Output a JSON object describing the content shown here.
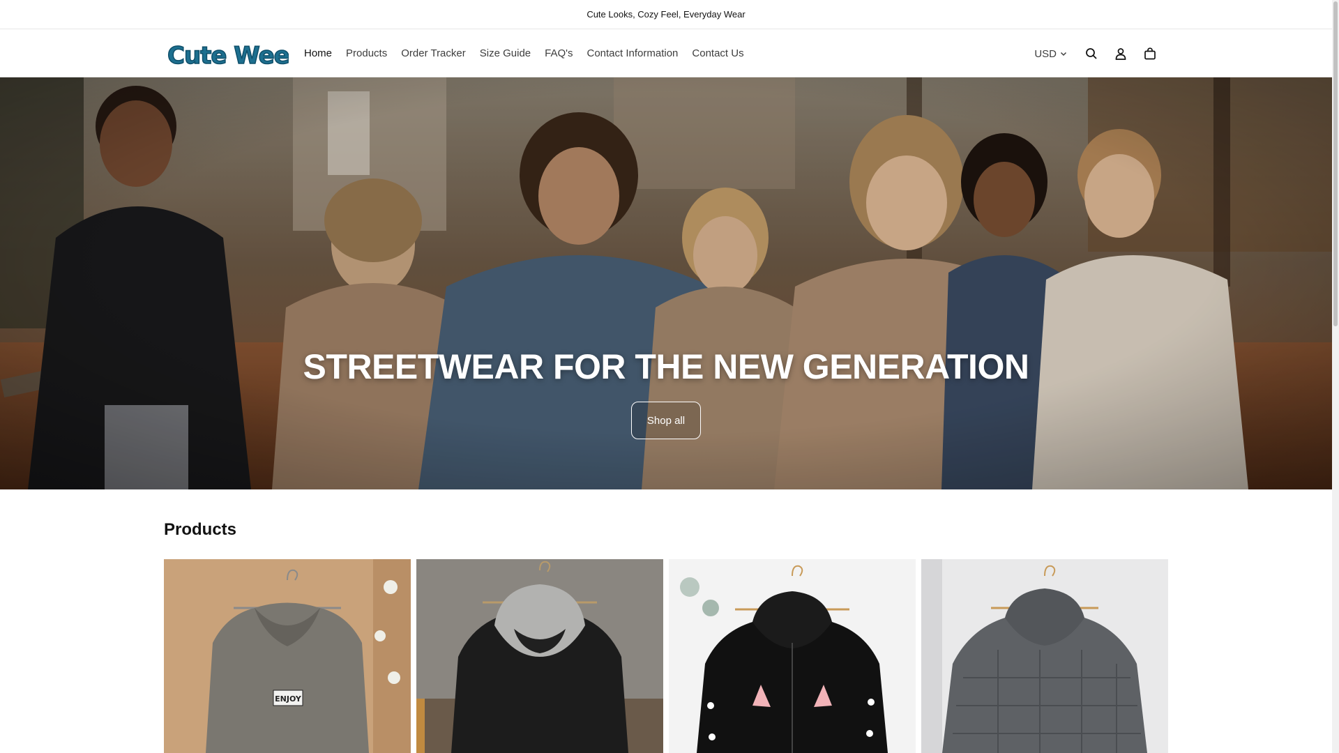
{
  "announcement": {
    "text": "Cute Looks, Cozy Feel, Everyday Wear"
  },
  "header": {
    "logo_text": "Cute Wee",
    "nav": [
      {
        "label": "Home"
      },
      {
        "label": "Products"
      },
      {
        "label": "Order Tracker"
      },
      {
        "label": "Size Guide"
      },
      {
        "label": "FAQ's"
      },
      {
        "label": "Contact Information"
      },
      {
        "label": "Contact Us"
      }
    ],
    "currency": "USD"
  },
  "hero": {
    "title": "STREETWEAR FOR THE NEW GENERATION",
    "button_label": "Shop all"
  },
  "products": {
    "title": "Products",
    "items": [
      {
        "name": "gray-sherpa-hoodie-enjoy",
        "patch_text": "ENJOY",
        "color": "#7a7770",
        "background": "#c9a27a"
      },
      {
        "name": "black-gray-hood-hoodie",
        "color": "#1c1c1c",
        "background": "#8a8680"
      },
      {
        "name": "black-cat-zip-hoodie",
        "color": "#111111",
        "background": "#f3f3f3"
      },
      {
        "name": "gray-plaid-fleece-hoodie",
        "color": "#5e6165",
        "background": "#e9e9ea"
      }
    ]
  },
  "colors": {
    "accent": "#121212",
    "hero_title": "#ffffff"
  }
}
